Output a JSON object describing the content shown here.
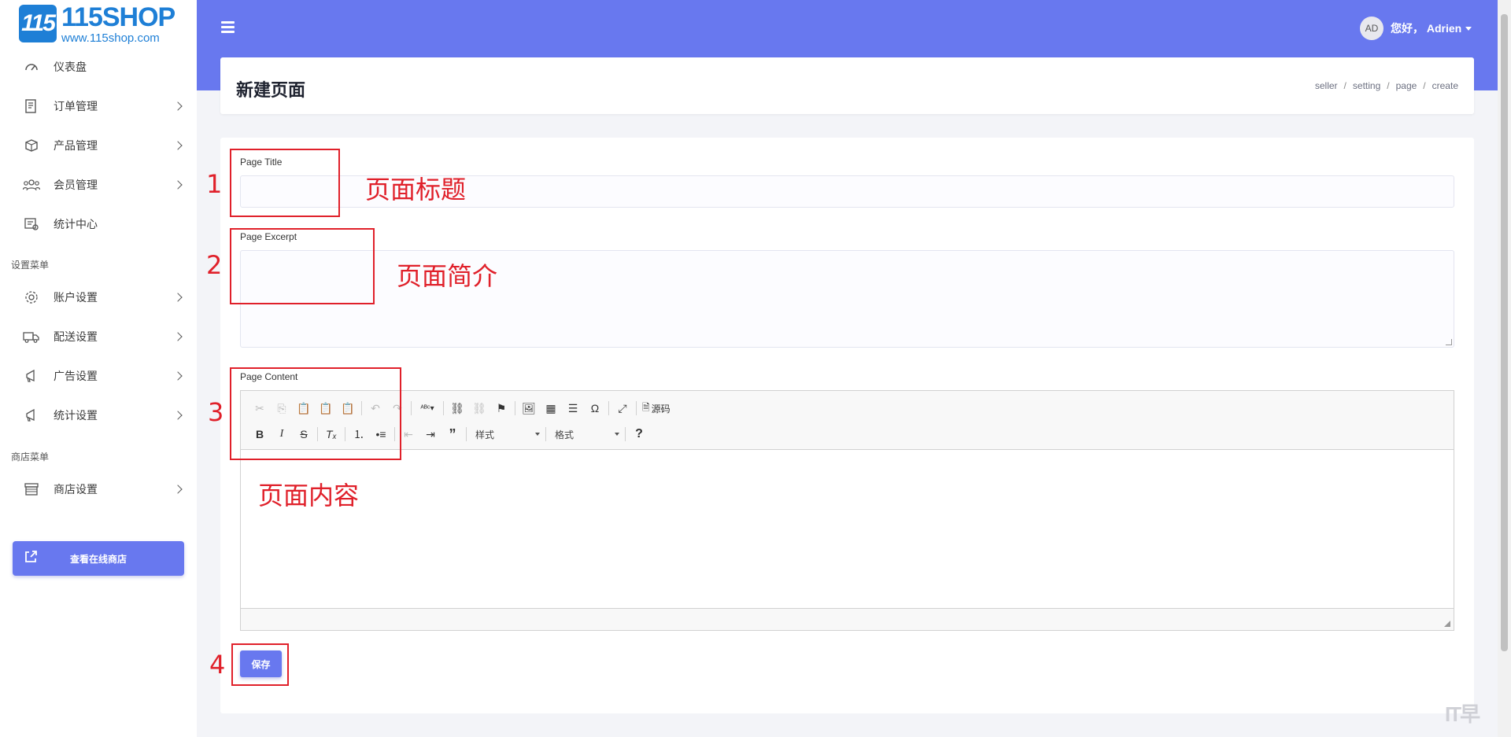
{
  "logo": {
    "mark": "115",
    "title": "115SHOP",
    "url": "www.115shop.com"
  },
  "sidebar": {
    "items": [
      {
        "label": "仪表盘",
        "icon": "dashboard-icon",
        "has_submenu": false
      },
      {
        "label": "订单管理",
        "icon": "order-icon",
        "has_submenu": true
      },
      {
        "label": "产品管理",
        "icon": "product-icon",
        "has_submenu": true
      },
      {
        "label": "会员管理",
        "icon": "members-icon",
        "has_submenu": true
      },
      {
        "label": "统计中心",
        "icon": "stats-icon",
        "has_submenu": false
      }
    ],
    "settings_section": "设置菜单",
    "settings_items": [
      {
        "label": "账户设置",
        "icon": "gear-icon",
        "has_submenu": true
      },
      {
        "label": "配送设置",
        "icon": "truck-icon",
        "has_submenu": true
      },
      {
        "label": "广告设置",
        "icon": "megaphone-icon",
        "has_submenu": true
      },
      {
        "label": "统计设置",
        "icon": "megaphone-icon",
        "has_submenu": true
      }
    ],
    "store_section": "商店菜单",
    "store_items": [
      {
        "label": "商店设置",
        "icon": "store-icon",
        "has_submenu": true
      }
    ],
    "view_store_button": "查看在线商店"
  },
  "topbar": {
    "avatar_initials": "AD",
    "greeting": "您好， Adrien"
  },
  "page": {
    "title": "新建页面",
    "breadcrumb": [
      "seller",
      "setting",
      "page",
      "create"
    ]
  },
  "form": {
    "title_label": "Page Title",
    "title_value": "",
    "excerpt_label": "Page Excerpt",
    "excerpt_value": "",
    "content_label": "Page Content",
    "source_label": "源码",
    "style_select": "样式",
    "format_select": "格式",
    "help": "?",
    "save_label": "保存"
  },
  "annotations": {
    "items": [
      {
        "num": "1",
        "text": "页面标题"
      },
      {
        "num": "2",
        "text": "页面简介"
      },
      {
        "num": "3",
        "text": "页面内容"
      },
      {
        "num": "4",
        "text": ""
      }
    ],
    "color": "#e0202a"
  },
  "colors": {
    "accent": "#6878ef",
    "annotation": "#e0202a"
  },
  "watermark": "IT早"
}
